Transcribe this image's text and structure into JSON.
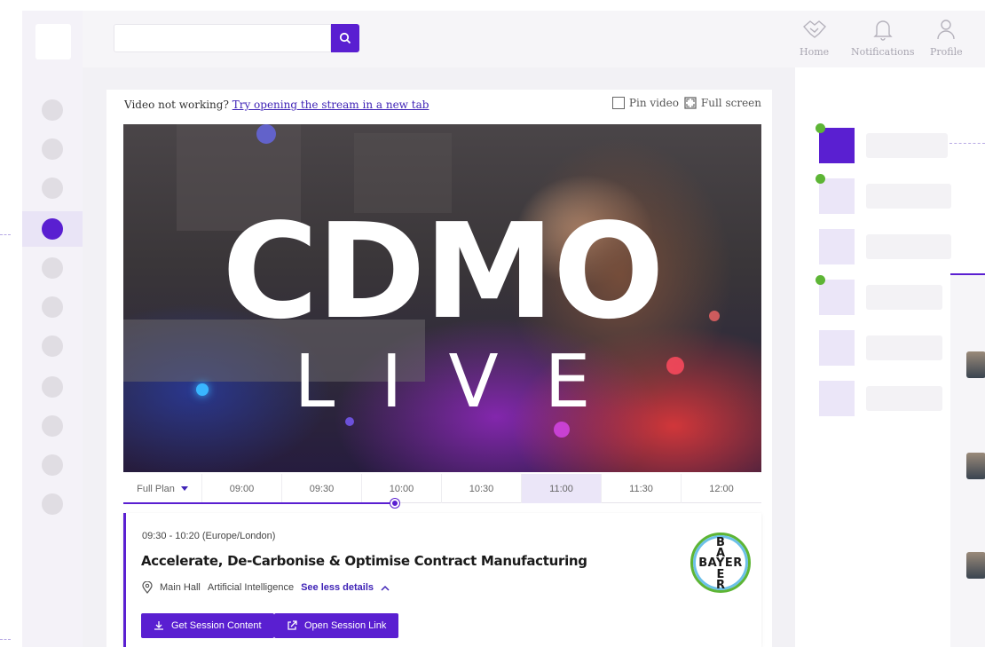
{
  "topbar": {
    "search_placeholder": "",
    "nav": [
      {
        "label": "Home",
        "icon": "handshake-icon"
      },
      {
        "label": "Notifications",
        "icon": "bell-icon"
      },
      {
        "label": "Profile",
        "icon": "user-icon"
      }
    ]
  },
  "stream": {
    "notice_prefix": "Video not working? ",
    "notice_link": "Try opening the stream in a new tab",
    "pin_label": "Pin video",
    "fullscreen_label": "Full screen"
  },
  "video": {
    "title_main": "CDMO",
    "title_sub": "LIVE"
  },
  "timeline": {
    "plan_label": "Full Plan",
    "slots": [
      "09:00",
      "09:30",
      "10:00",
      "10:30",
      "11:00",
      "11:30",
      "12:00"
    ],
    "highlighted_slot": "11:00",
    "progress": 0.43
  },
  "session": {
    "time": "09:30 - 10:20 (Europe/London)",
    "title": "Accelerate, De-Carbonise & Optimise Contract Manufacturing",
    "location": "Main Hall",
    "track": "Artificial Intelligence",
    "toggle_details": "See less details",
    "btn_content": "Get Session Content",
    "btn_link": "Open Session Link",
    "sponsor_logo_text": "BAYER"
  },
  "colors": {
    "accent": "#5a1fd1",
    "accent_light": "#ebe6f8",
    "status_green": "#5db535"
  }
}
